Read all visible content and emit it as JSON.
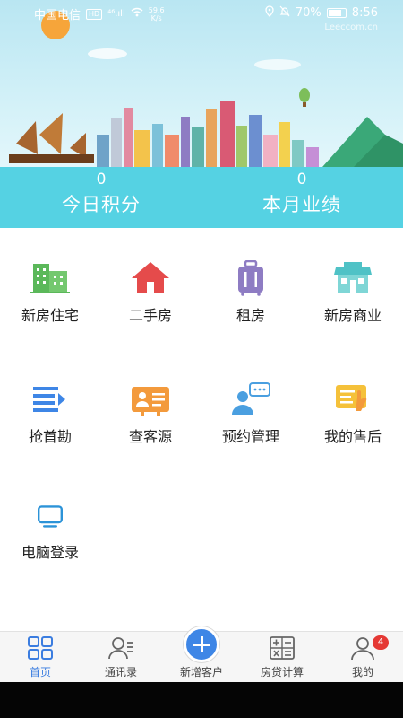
{
  "status_bar": {
    "carrier": "中国电信",
    "network_badge": "HD",
    "signal": "⁴⁶.ıll",
    "speed_value": "59.6",
    "speed_unit": "K/s",
    "battery": "70%",
    "time": "8:56",
    "watermark": "Leeccom.cn"
  },
  "stats": {
    "today_points_value": "0",
    "today_points_label": "今日积分",
    "month_perf_value": "0",
    "month_perf_label": "本月业绩"
  },
  "menu": [
    {
      "label": "新房住宅",
      "icon": "building-icon"
    },
    {
      "label": "二手房",
      "icon": "house-icon"
    },
    {
      "label": "租房",
      "icon": "suitcase-icon"
    },
    {
      "label": "新房商业",
      "icon": "store-icon"
    },
    {
      "label": "抢首勘",
      "icon": "list-arrow-icon"
    },
    {
      "label": "查客源",
      "icon": "id-card-icon"
    },
    {
      "label": "预约管理",
      "icon": "user-chat-icon"
    },
    {
      "label": "我的售后",
      "icon": "doc-hand-icon"
    },
    {
      "label": "电脑登录",
      "icon": "monitor-icon"
    }
  ],
  "tabs": [
    {
      "label": "首页",
      "icon": "grid-icon",
      "active": true
    },
    {
      "label": "通讯录",
      "icon": "contacts-icon"
    },
    {
      "label": "新增客户",
      "icon": "plus-icon"
    },
    {
      "label": "房贷计算",
      "icon": "calculator-icon"
    },
    {
      "label": "我的",
      "icon": "user-icon",
      "badge": "4"
    }
  ],
  "colors": {
    "band": "#55d2e3",
    "accent": "#3e86e6",
    "badge": "#e53935",
    "tab_active": "#3b7de0"
  }
}
